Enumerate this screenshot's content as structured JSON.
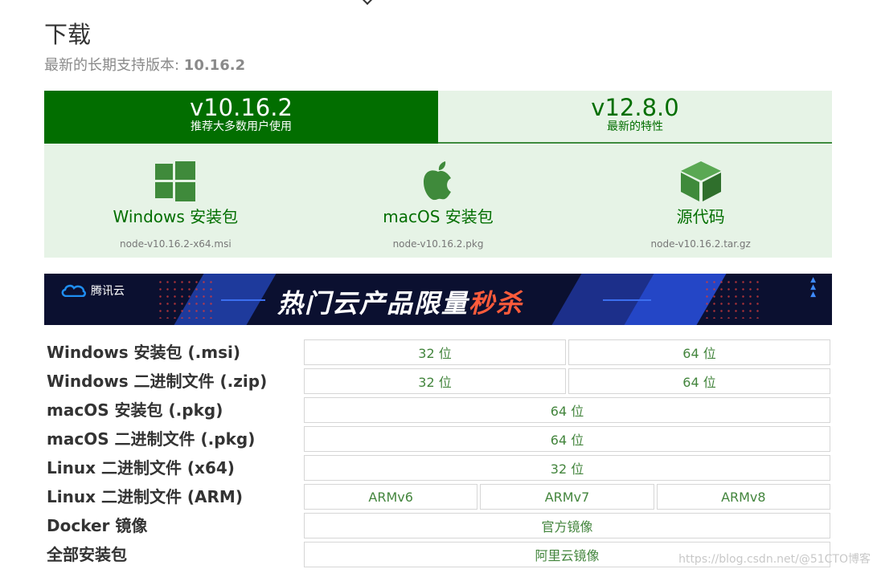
{
  "page": {
    "title": "下载",
    "subtitle_prefix": "最新的长期支持版本: ",
    "subtitle_version": "10.16.2"
  },
  "tabs": [
    {
      "version": "v10.16.2",
      "desc": "推荐大多数用户使用"
    },
    {
      "version": "v12.8.0",
      "desc": "最新的特性"
    }
  ],
  "downloads": [
    {
      "icon": "windows-icon",
      "label": "Windows 安装包",
      "file": "node-v10.16.2-x64.msi"
    },
    {
      "icon": "apple-icon",
      "label": "macOS 安装包",
      "file": "node-v10.16.2.pkg"
    },
    {
      "icon": "cube-icon",
      "label": "源代码",
      "file": "node-v10.16.2.tar.gz"
    }
  ],
  "banner": {
    "brand": "腾讯云",
    "headline": "热门云产品限量",
    "headline_accent": "秒杀"
  },
  "matrix": [
    {
      "label": "Windows 安装包 (.msi)",
      "cells": [
        "32 位",
        "64 位"
      ]
    },
    {
      "label": "Windows 二进制文件 (.zip)",
      "cells": [
        "32 位",
        "64 位"
      ]
    },
    {
      "label": "macOS 安装包 (.pkg)",
      "cells": [
        "64 位"
      ]
    },
    {
      "label": "macOS 二进制文件 (.pkg)",
      "cells": [
        "64 位"
      ]
    },
    {
      "label": "Linux 二进制文件 (x64)",
      "cells": [
        "32 位"
      ]
    },
    {
      "label": "Linux 二进制文件 (ARM)",
      "cells": [
        "ARMv6",
        "ARMv7",
        "ARMv8"
      ]
    },
    {
      "label": "Docker 镜像",
      "cells": [
        "官方镜像"
      ]
    },
    {
      "label": "全部安装包",
      "cells": [
        "阿里云镜像"
      ]
    }
  ],
  "watermark": "https://blog.csdn.net/@51CTO博客",
  "colors": {
    "brand_green": "#026e00",
    "light_green": "#e6f3e6",
    "link_green": "#43853d"
  }
}
